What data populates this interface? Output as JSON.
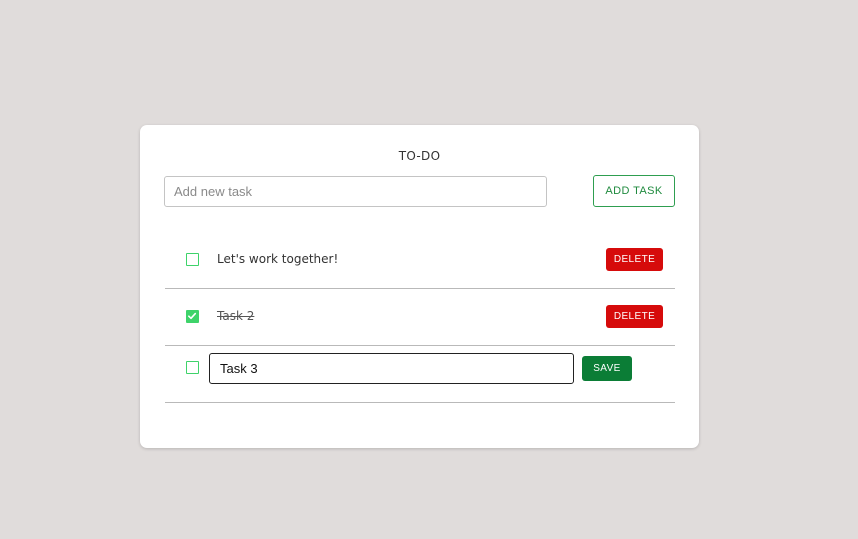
{
  "header": {
    "title": "TO-DO"
  },
  "new_task": {
    "placeholder": "Add new task",
    "value": "",
    "add_label": "ADD TASK"
  },
  "tasks": [
    {
      "label": "Let's work together!",
      "completed": false,
      "action_label": "DELETE"
    },
    {
      "label": "Task 2",
      "completed": true,
      "action_label": "DELETE"
    },
    {
      "label": "Task 3",
      "completed": false,
      "editing": true,
      "action_label": "SAVE"
    }
  ],
  "colors": {
    "background": "#e0dcdb",
    "checkbox_green": "#3ed36a",
    "add_button_green": "#1f8a3e",
    "delete_red": "#d60b0b",
    "save_green": "#0b7d36"
  },
  "icons": {
    "checkmark": "check-icon"
  }
}
